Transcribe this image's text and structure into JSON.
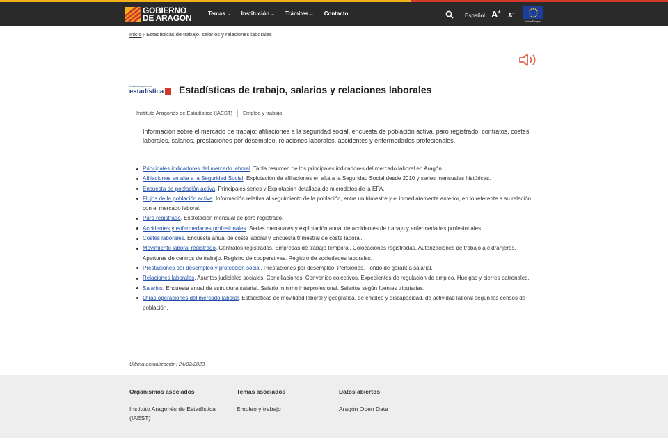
{
  "header": {
    "logo_line1": "GOBIERNO",
    "logo_line2": "DE ARAGON",
    "nav": [
      {
        "label": "Temas"
      },
      {
        "label": "Institución"
      },
      {
        "label": "Trámites"
      },
      {
        "label": "Contacto"
      }
    ],
    "language": "Español",
    "font_increase": "A",
    "font_decrease": "A",
    "font_increase_sign": "+",
    "font_decrease_sign": "-",
    "eu_caption": "Unión Europea"
  },
  "breadcrumb": {
    "home": "Inicio",
    "separator": "›",
    "current": "Estadísticas de trabajo, salarios y relaciones laborales"
  },
  "page": {
    "iaest_logo_small": "Instituto aragonés de",
    "iaest_logo_main": "estadística",
    "title": "Estadísticas de trabajo, salarios y relaciones laborales",
    "tags": [
      "Instituto Aragonés de Estadística (IAEST)",
      "Empleo y trabajo"
    ],
    "lead": "Información sobre el mercado de trabajo: afiliaciones a la seguridad social, encuesta de población activa, paro registrado, contratos, costes laborales, salarios, prestaciones por desempleo, relaciones laborales, accidentes y enfermedades profesionales.",
    "items": [
      {
        "link": "Principales indicadores del mercado laboral",
        "text": ". Tabla resumen de los principales indicadores del mercado laboral en Aragón."
      },
      {
        "link": "Afiliaciones en alta a la Seguridad Social",
        "text": ". Explotación  de afiliaciones en alta a la Seguridad Social desde 2010 y series mensuales históricas."
      },
      {
        "link": "Encuesta de población activa",
        "text": ". Principales series y Explotación detallada de microdatos de la EPA."
      },
      {
        "link": "Flujos de la población activa",
        "text": ". Información relativa al seguimiento de la población, entre un trimestre y el inmediatamente anterior, en lo referente a su relación con el mercado laboral."
      },
      {
        "link": "Paro registrado",
        "text": ". Explotación mensual de paro registrado."
      },
      {
        "link": "Accidentes y enfermedades profesionales",
        "text": ". Series mensuales y explotación anual de accidentes de trabajo y enfermedades profesionales."
      },
      {
        "link": "Costes laborales",
        "text": ". Encuesta anual de coste laboral y Encuesta trimestral de coste laboral."
      },
      {
        "link": "Movimiento laboral registrado",
        "text": ". Contratos registrados. Empresas de trabajo temporal. Colocaciones registradas. Autorizaciones de trabajo a extranjeros. Aperturas de centros de trabajo. Registro de cooperativas. Registro de sociedades laborales."
      },
      {
        "link": "Prestaciones por desempleo y protección social",
        "text": ". Prestaciones por desempleo. Pensiones. Fondo de garantía salarial."
      },
      {
        "link": "Relaciones laborales",
        "text": ". Asuntos judiciales sociales. Conciliaciones. Convenios colectivos. Expedientes de regulación de empleo. Huelgas y cierres patronales."
      },
      {
        "link": "Salarios",
        "text": ". Encuesta anual de estructura salarial. Salario mínimo interprofesional. Salarios según fuentes tributarias."
      },
      {
        "link": "Otras operaciones del mercado laboral",
        "text": ". Estadísticas de movilidad laboral y geográfica, de empleo y discapacidad, de actividad laboral según los censos de población."
      }
    ],
    "updated": "Última actualización: 24/02/2023"
  },
  "footer": {
    "columns": [
      {
        "heading": "Organismos asociados",
        "item": "Instituto Aragonés de Estadística (IAEST)"
      },
      {
        "heading": "Temas asociados",
        "item": "Empleo y trabajo"
      },
      {
        "heading": "Datos abiertos",
        "item": "Aragón Open Data"
      }
    ]
  },
  "colors": {
    "header_bg": "#2a2a2a",
    "accent_red": "#d33a2c",
    "accent_yellow": "#f2b21b",
    "link_blue": "#1f4ea8",
    "footer_bg": "#eeeeee"
  }
}
